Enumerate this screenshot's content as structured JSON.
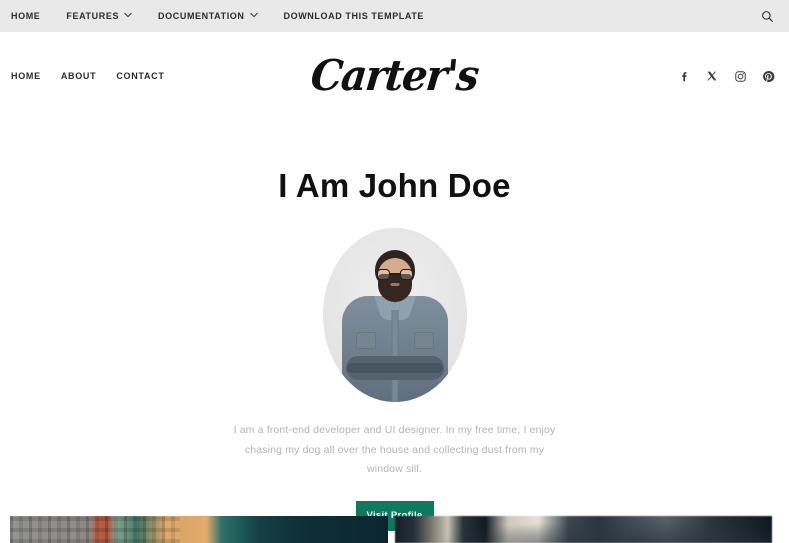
{
  "topbar": {
    "items": [
      {
        "label": "HOME",
        "has_dropdown": false
      },
      {
        "label": "FEATURES",
        "has_dropdown": true
      },
      {
        "label": "DOCUMENTATION",
        "has_dropdown": true
      },
      {
        "label": "DOWNLOAD THIS TEMPLATE",
        "has_dropdown": false
      }
    ],
    "search_icon": "search-icon",
    "background_color": "#e9e9e9"
  },
  "masthead": {
    "nav": [
      {
        "label": "HOME"
      },
      {
        "label": "ABOUT"
      },
      {
        "label": "CONTACT"
      }
    ],
    "logo": "Carter's",
    "socials": [
      {
        "name": "facebook-icon"
      },
      {
        "name": "x-twitter-icon"
      },
      {
        "name": "instagram-icon"
      },
      {
        "name": "pinterest-icon"
      }
    ]
  },
  "hero": {
    "title": "I Am John Doe",
    "avatar_alt": "Bearded man with glasses wearing a denim shirt, arms crossed",
    "bio": "I am a front-end developer and UI designer. In my free time, I enjoy chasing my dog all over the house and collecting dust from my window sill.",
    "button_label": "Visit Profile",
    "button_color": "#0d7a5e",
    "title_color": "#111111",
    "bio_color": "#b3b3b3"
  },
  "cards": [
    {
      "name": "card-city-buildings",
      "alt": "City street with stone and brick buildings and fire escapes"
    },
    {
      "name": "card-person-blurred",
      "alt": "Blurred photo of a person in a dark jacket"
    }
  ]
}
